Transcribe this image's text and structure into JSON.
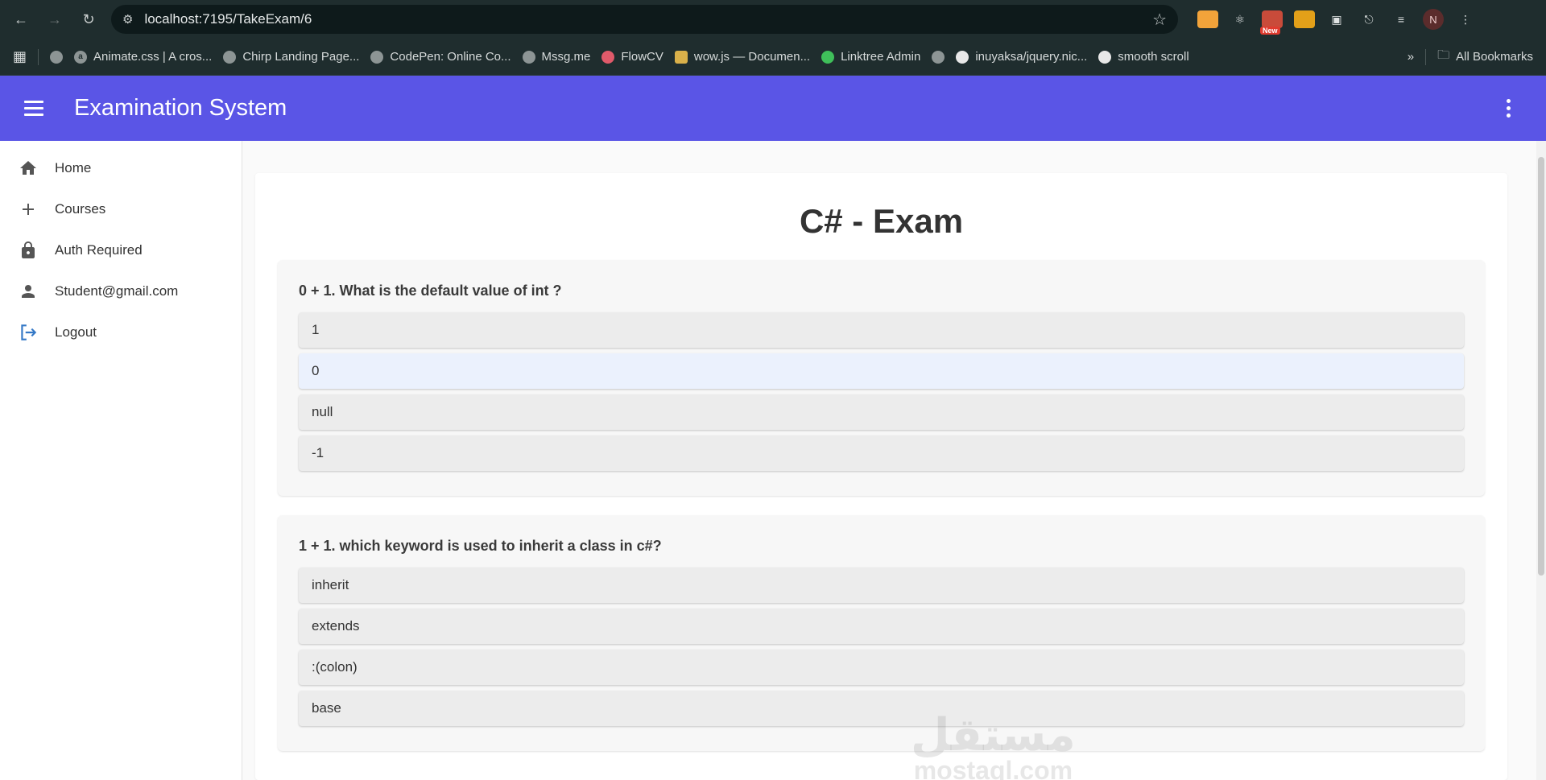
{
  "browser": {
    "url": "localhost:7195/TakeExam/6",
    "new_badge": "New",
    "profile_initial": "N",
    "bookmarks": [
      {
        "label": "Animate.css | A cros...",
        "icon": "a"
      },
      {
        "label": "Chirp Landing Page...",
        "icon": ""
      },
      {
        "label": "CodePen: Online Co...",
        "icon": ""
      },
      {
        "label": "Mssg.me",
        "icon": ""
      },
      {
        "label": "FlowCV",
        "icon": ""
      },
      {
        "label": "wow.js — Documen...",
        "icon": ""
      },
      {
        "label": "Linktree Admin",
        "icon": ""
      },
      {
        "label": "inuyaksa/jquery.nic...",
        "icon": ""
      },
      {
        "label": "smooth scroll",
        "icon": ""
      }
    ],
    "all_bookmarks": "All Bookmarks"
  },
  "app": {
    "title": "Examination System"
  },
  "sidebar": {
    "items": [
      {
        "label": "Home",
        "icon": "home-icon"
      },
      {
        "label": "Courses",
        "icon": "plus-icon"
      },
      {
        "label": "Auth Required",
        "icon": "lock-icon"
      },
      {
        "label": "Student@gmail.com",
        "icon": "person-icon"
      },
      {
        "label": "Logout",
        "icon": "logout-icon"
      }
    ]
  },
  "exam": {
    "title": "C# - Exam",
    "questions": [
      {
        "text": "0 + 1. What is the default value of int ?",
        "options": [
          "1",
          "0",
          "null",
          "-1"
        ],
        "selected": 1
      },
      {
        "text": "1 + 1. which keyword is used to inherit a class in c#?",
        "options": [
          "inherit",
          "extends",
          ":(colon)",
          "base"
        ],
        "selected": -1
      }
    ]
  },
  "watermark": {
    "arabic": "مستقل",
    "latin": "mostaql.com"
  },
  "colors": {
    "app_bar": "#5a55e6",
    "selected_option": "#ebf1fd"
  }
}
